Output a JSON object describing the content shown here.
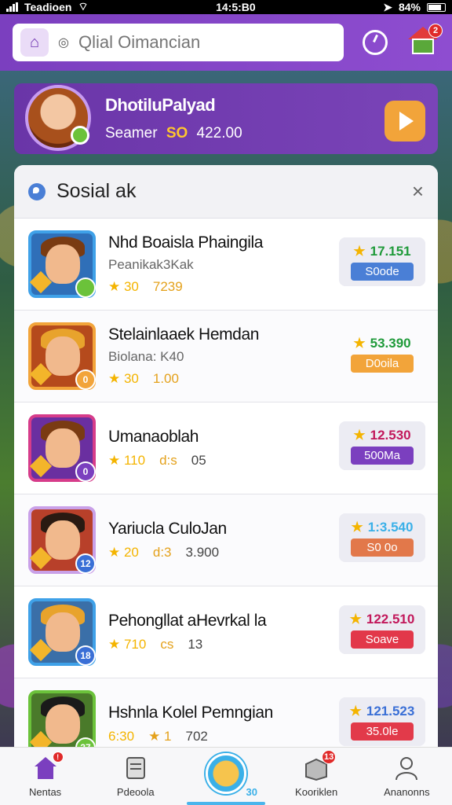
{
  "status_bar": {
    "carrier": "Teadioen",
    "time": "14:5:B0",
    "battery": "84%"
  },
  "header": {
    "search_placeholder": "Qlial Oimancian",
    "notifications_count": "2"
  },
  "profile": {
    "name": "DhotiluPalyad",
    "score_label": "Seamer",
    "score_highlight": "SO",
    "score_value": "422.00"
  },
  "panel": {
    "title": "Sosial ak",
    "close_glyph": "×"
  },
  "rows": [
    {
      "name": "Nhd Boaisla Phaingila",
      "sub": "Peanikak3Kak",
      "stat1": "★ 30",
      "stat2": "7239",
      "badge": "",
      "right_top": "17.151",
      "right_pill": "S0ode",
      "top_color": "#1f9a3a",
      "pill_color": "#4a7fd6"
    },
    {
      "name": "Stelainlaaek Hemdan",
      "sub": "Biolana: K40",
      "stat1": "★ 30",
      "stat2": "1.00",
      "badge": "0",
      "right_top": "53.390",
      "right_pill": "D0oila",
      "top_color": "#1f9a3a",
      "pill_color": "#f2a43a"
    },
    {
      "name": "Umanaoblah",
      "sub": "",
      "stat1": "★ 110",
      "stat2": "d:s",
      "stat3": "05",
      "badge": "0",
      "right_top": "12.530",
      "right_pill": "500Ma",
      "top_color": "#c2185b",
      "pill_color": "#7b3fbf"
    },
    {
      "name": "Yariucla CuloJan",
      "sub": "",
      "stat1": "★ 20",
      "stat2": "d:3",
      "stat3": "3.900",
      "badge": "12",
      "right_top": "1:3.540",
      "right_pill": "S0 0o",
      "top_color": "#3ab0e8",
      "pill_color": "#e2784a"
    },
    {
      "name": "Pehongllat aHevrkal la",
      "sub": "",
      "stat1": "★ 710",
      "stat2": "cs",
      "stat3": "13",
      "badge": "18",
      "right_top": "122.510",
      "right_pill": "Soave",
      "top_color": "#c2185b",
      "pill_color": "#e2384a"
    },
    {
      "name": "Hshnla Kolel Pemngian",
      "sub": "",
      "stat1": "6:30",
      "stat2": "★ 1",
      "stat3": "702",
      "badge": "37",
      "right_top": "121.523",
      "right_pill": "35.0le",
      "top_color": "#3a6fd6",
      "pill_color": "#e23a4a"
    }
  ],
  "bottom_nav": {
    "items": [
      {
        "label": "Nentas"
      },
      {
        "label": "Pdeoola"
      },
      {
        "label": ""
      },
      {
        "label": "Kooriklen"
      },
      {
        "label": "Ananonns"
      }
    ],
    "center_badge": "30"
  }
}
